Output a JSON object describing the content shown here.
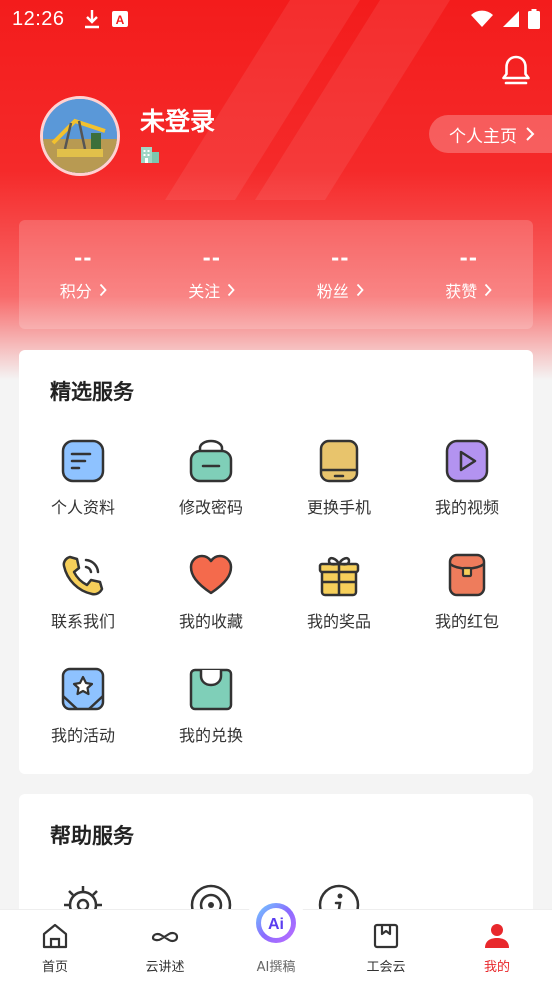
{
  "status_bar": {
    "time": "12:26",
    "icons": [
      "download-icon",
      "a-box-icon",
      "wifi-icon",
      "signal-icon",
      "battery-icon"
    ]
  },
  "profile": {
    "username": "未登录",
    "homepage_label": "个人主页"
  },
  "stats": [
    {
      "value": "--",
      "label": "积分"
    },
    {
      "value": "--",
      "label": "关注"
    },
    {
      "value": "--",
      "label": "粉丝"
    },
    {
      "value": "--",
      "label": "获赞"
    }
  ],
  "featured": {
    "title": "精选服务",
    "items": [
      {
        "label": "个人资料",
        "icon": "profile-doc-icon"
      },
      {
        "label": "修改密码",
        "icon": "lock-icon"
      },
      {
        "label": "更换手机",
        "icon": "phone-icon"
      },
      {
        "label": "我的视频",
        "icon": "video-icon"
      },
      {
        "label": "联系我们",
        "icon": "call-icon"
      },
      {
        "label": "我的收藏",
        "icon": "heart-icon"
      },
      {
        "label": "我的奖品",
        "icon": "gift-icon"
      },
      {
        "label": "我的红包",
        "icon": "red-envelope-icon"
      },
      {
        "label": "我的活动",
        "icon": "activity-icon"
      },
      {
        "label": "我的兑换",
        "icon": "shopping-bag-icon"
      }
    ]
  },
  "help": {
    "title": "帮助服务"
  },
  "tabbar": {
    "tabs": [
      {
        "label": "首页",
        "icon": "home-icon"
      },
      {
        "label": "云讲述",
        "icon": "cloud-talk-icon"
      },
      {
        "label": "AI撰稿",
        "icon": "ai-icon"
      },
      {
        "label": "工会云",
        "icon": "bookmark-icon"
      },
      {
        "label": "我的",
        "icon": "person-icon"
      }
    ],
    "active": "我的",
    "accent_color": "#e8282c"
  },
  "colors": {
    "brand_red": "#f31c1c",
    "accent": "#e8282c"
  }
}
